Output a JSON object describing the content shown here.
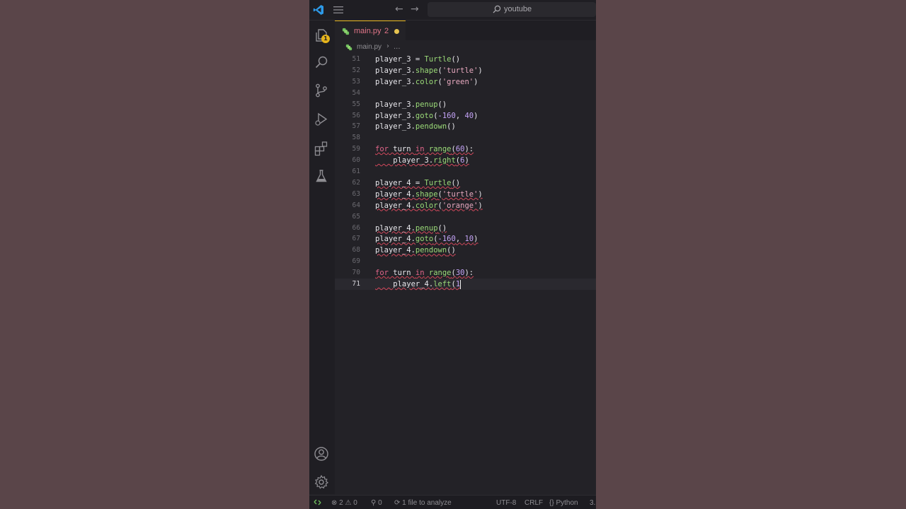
{
  "titlebar": {
    "search_text": "youtube"
  },
  "activity_badge": "1",
  "tab": {
    "label": "main.py",
    "problems": "2"
  },
  "breadcrumb": {
    "file": "main.py",
    "more": "..."
  },
  "lines": [
    {
      "n": "51",
      "code": "player_3 = Turtle()"
    },
    {
      "n": "52",
      "code": "player_3.shape('turtle')"
    },
    {
      "n": "53",
      "code": "player_3.color('green')"
    },
    {
      "n": "54",
      "code": ""
    },
    {
      "n": "55",
      "code": "player_3.penup()"
    },
    {
      "n": "56",
      "code": "player_3.goto(-160, 40)"
    },
    {
      "n": "57",
      "code": "player_3.pendown()"
    },
    {
      "n": "58",
      "code": ""
    },
    {
      "n": "59",
      "code": "for turn in range(60):"
    },
    {
      "n": "60",
      "code": "    player_3.right(6)"
    },
    {
      "n": "61",
      "code": ""
    },
    {
      "n": "62",
      "code": "player_4 = Turtle()"
    },
    {
      "n": "63",
      "code": "player_4.shape('turtle')"
    },
    {
      "n": "64",
      "code": "player_4.color('orange')"
    },
    {
      "n": "65",
      "code": ""
    },
    {
      "n": "66",
      "code": "player_4.penup()"
    },
    {
      "n": "67",
      "code": "player_4.goto(-160, 10)"
    },
    {
      "n": "68",
      "code": "player_4.pendown()"
    },
    {
      "n": "69",
      "code": ""
    },
    {
      "n": "70",
      "code": "for turn in range(30):"
    },
    {
      "n": "71",
      "code": "    player_4.left(1"
    }
  ],
  "statusbar": {
    "errors": "2",
    "warnings": "0",
    "ports": "0",
    "analyze": "1 file to analyze",
    "encoding": "UTF-8",
    "eol": "CRLF",
    "language": "Python",
    "version": "3."
  },
  "colors": {
    "background": "#5b464a",
    "editor": "#232227",
    "accent": "#e6b41c",
    "error": "#d4485c"
  }
}
